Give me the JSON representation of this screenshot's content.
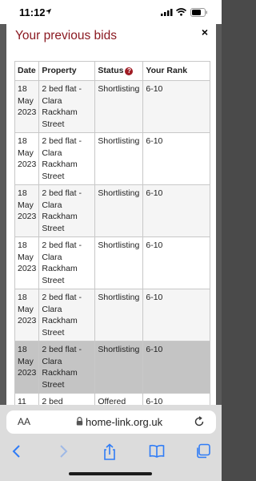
{
  "status_bar": {
    "time": "11:12"
  },
  "modal": {
    "title": "Your previous bids",
    "close_label": "×"
  },
  "table": {
    "headers": {
      "date": "Date",
      "property": "Property",
      "status": "Status",
      "rank": "Your Rank"
    },
    "status_help_glyph": "?",
    "rows": [
      {
        "date_line1": "18",
        "date_line2": "May",
        "date_line3": "2023",
        "prop_line1": "2 bed flat -",
        "prop_line2": "Clara",
        "prop_line3": "Rackham",
        "prop_line4": "Street",
        "status": "Shortlisting",
        "rank": "6-10"
      },
      {
        "date_line1": "18",
        "date_line2": "May",
        "date_line3": "2023",
        "prop_line1": "2 bed flat -",
        "prop_line2": "Clara",
        "prop_line3": "Rackham",
        "prop_line4": "Street",
        "status": "Shortlisting",
        "rank": "6-10"
      },
      {
        "date_line1": "18",
        "date_line2": "May",
        "date_line3": "2023",
        "prop_line1": "2 bed flat -",
        "prop_line2": "Clara",
        "prop_line3": "Rackham",
        "prop_line4": "Street",
        "status": "Shortlisting",
        "rank": "6-10"
      },
      {
        "date_line1": "18",
        "date_line2": "May",
        "date_line3": "2023",
        "prop_line1": "2 bed flat -",
        "prop_line2": "Clara",
        "prop_line3": "Rackham",
        "prop_line4": "Street",
        "status": "Shortlisting",
        "rank": "6-10"
      },
      {
        "date_line1": "18",
        "date_line2": "May",
        "date_line3": "2023",
        "prop_line1": "2 bed flat -",
        "prop_line2": "Clara",
        "prop_line3": "Rackham",
        "prop_line4": "Street",
        "status": "Shortlisting",
        "rank": "6-10"
      },
      {
        "date_line1": "18",
        "date_line2": "May",
        "date_line3": "2023",
        "prop_line1": "2 bed flat -",
        "prop_line2": "Clara",
        "prop_line3": "Rackham",
        "prop_line4": "Street",
        "status": "Shortlisting",
        "rank": "6-10"
      },
      {
        "date_line1": "11",
        "prop_line1": "2 bed",
        "status": "Offered",
        "rank": "6-10"
      }
    ]
  },
  "browser": {
    "aa_label": "AA",
    "url": "home-link.org.uk"
  },
  "colors": {
    "title": "#8b1a22",
    "help_icon": "#a01c24",
    "safari_blue": "#2f7cf6",
    "selected_row": "#c4c4c4"
  },
  "icons": [
    "location-arrow-icon",
    "cellular-signal-icon",
    "wifi-icon",
    "battery-icon",
    "help-icon",
    "close-icon",
    "lock-icon",
    "reload-icon",
    "back-icon",
    "forward-icon",
    "share-icon",
    "bookmarks-icon",
    "tabs-icon"
  ]
}
